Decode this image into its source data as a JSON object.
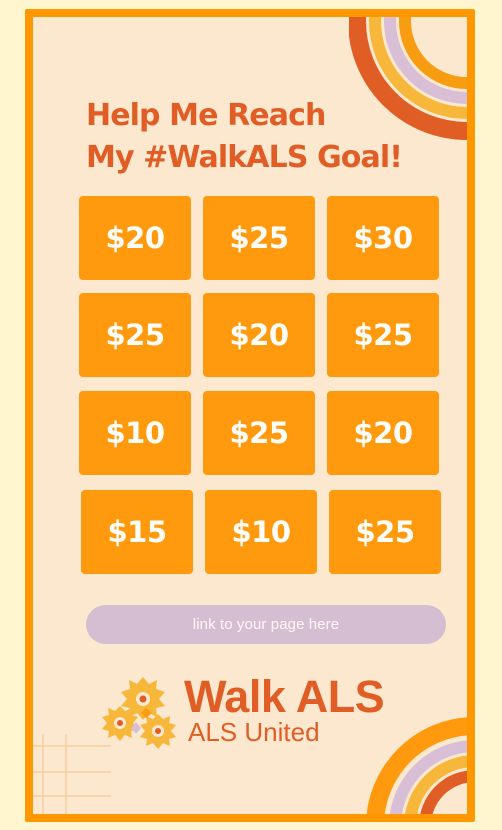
{
  "headline": {
    "line1": "Help Me Reach",
    "line2": "My #WalkALS Goal!"
  },
  "amounts": [
    "$20",
    "$25",
    "$30",
    "$25",
    "$20",
    "$25",
    "$10",
    "$25",
    "$20",
    "$15",
    "$10",
    "$25"
  ],
  "cta": {
    "label": "link to your page here"
  },
  "brand": {
    "title": "Walk ALS",
    "subtitle": "ALS United"
  },
  "colors": {
    "background": "#fff6cf",
    "card": "#fbe8cf",
    "frame": "#ff9800",
    "accent": "#e05e26",
    "amount_tile": "#ff9a0f",
    "link_pill": "#d5bed1",
    "lavender_stripe": "#d8bfd6",
    "gold_stripe": "#f6b73a"
  },
  "icons": {
    "logo": "walk-als-logo-icon",
    "top_arc": "rainbow-arc-icon",
    "bottom_arc": "rainbow-arc-icon",
    "grid": "grid-lines-icon"
  }
}
